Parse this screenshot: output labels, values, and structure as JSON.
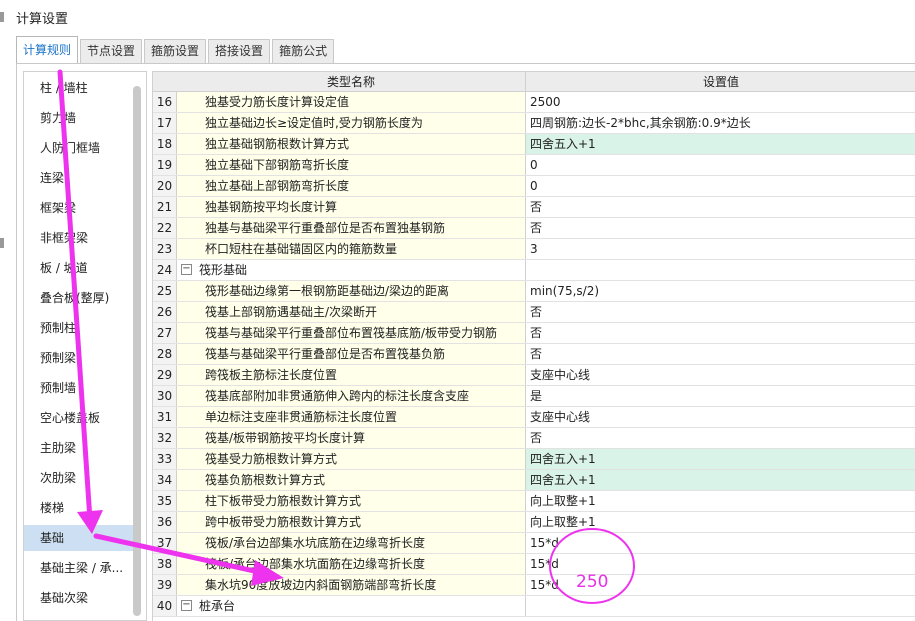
{
  "window": {
    "title": "计算设置"
  },
  "tabs": [
    {
      "label": "计算规则",
      "active": true
    },
    {
      "label": "节点设置",
      "active": false
    },
    {
      "label": "箍筋设置",
      "active": false
    },
    {
      "label": "搭接设置",
      "active": false
    },
    {
      "label": "箍筋公式",
      "active": false
    }
  ],
  "sidebar": {
    "items": [
      {
        "label": "柱 / 墙柱"
      },
      {
        "label": "剪力墙"
      },
      {
        "label": "人防门框墙"
      },
      {
        "label": "连梁"
      },
      {
        "label": "框架梁"
      },
      {
        "label": "非框架梁"
      },
      {
        "label": "板 / 坡道"
      },
      {
        "label": "叠合板(整厚)"
      },
      {
        "label": "预制柱"
      },
      {
        "label": "预制梁"
      },
      {
        "label": "预制墙"
      },
      {
        "label": "空心楼盖板"
      },
      {
        "label": "主肋梁"
      },
      {
        "label": "次肋梁"
      },
      {
        "label": "楼梯"
      },
      {
        "label": "基础",
        "selected": true
      },
      {
        "label": "基础主梁 / 承..."
      },
      {
        "label": "基础次梁"
      }
    ]
  },
  "grid": {
    "header": {
      "name": "类型名称",
      "value": "设置值"
    },
    "rows": [
      {
        "num": "16",
        "name": "独基受力筋长度计算设定值",
        "value": "2500"
      },
      {
        "num": "17",
        "name": "独立基础边长≥设定值时,受力钢筋长度为",
        "value": "四周钢筋:边长-2*bhc,其余钢筋:0.9*边长"
      },
      {
        "num": "18",
        "name": "独立基础钢筋根数计算方式",
        "value": "四舍五入+1",
        "highlight": true
      },
      {
        "num": "19",
        "name": "独立基础下部钢筋弯折长度",
        "value": "0"
      },
      {
        "num": "20",
        "name": "独立基础上部钢筋弯折长度",
        "value": "0"
      },
      {
        "num": "21",
        "name": "独基钢筋按平均长度计算",
        "value": "否"
      },
      {
        "num": "22",
        "name": "独基与基础梁平行重叠部位是否布置独基钢筋",
        "value": "否"
      },
      {
        "num": "23",
        "name": "杯口短柱在基础锚固区内的箍筋数量",
        "value": "3"
      },
      {
        "num": "24",
        "name": "筏形基础",
        "value": "",
        "group": true,
        "toggle": "−"
      },
      {
        "num": "25",
        "name": "筏形基础边缘第一根钢筋距基础边/梁边的距离",
        "value": "min(75,s/2)"
      },
      {
        "num": "26",
        "name": "筏基上部钢筋遇基础主/次梁断开",
        "value": "否"
      },
      {
        "num": "27",
        "name": "筏基与基础梁平行重叠部位布置筏基底筋/板带受力钢筋",
        "value": "否"
      },
      {
        "num": "28",
        "name": "筏基与基础梁平行重叠部位是否布置筏基负筋",
        "value": "否"
      },
      {
        "num": "29",
        "name": "跨筏板主筋标注长度位置",
        "value": "支座中心线"
      },
      {
        "num": "30",
        "name": "筏基底部附加非贯通筋伸入跨内的标注长度含支座",
        "value": "是"
      },
      {
        "num": "31",
        "name": "单边标注支座非贯通筋标注长度位置",
        "value": "支座中心线"
      },
      {
        "num": "32",
        "name": "筏基/板带钢筋按平均长度计算",
        "value": "否"
      },
      {
        "num": "33",
        "name": "筏基受力筋根数计算方式",
        "value": "四舍五入+1",
        "highlight": true
      },
      {
        "num": "34",
        "name": "筏基负筋根数计算方式",
        "value": "四舍五入+1",
        "highlight": true
      },
      {
        "num": "35",
        "name": "柱下板带受力筋根数计算方式",
        "value": "向上取整+1"
      },
      {
        "num": "36",
        "name": "跨中板带受力筋根数计算方式",
        "value": "向上取整+1"
      },
      {
        "num": "37",
        "name": "筏板/承台边部集水坑底筋在边缘弯折长度",
        "value": "15*d"
      },
      {
        "num": "38",
        "name": "筏板/承台边部集水坑面筋在边缘弯折长度",
        "value": "15*d"
      },
      {
        "num": "39",
        "name": "集水坑90度放坡边内斜面钢筋端部弯折长度",
        "value": "15*d"
      },
      {
        "num": "40",
        "name": "桩承台",
        "value": "",
        "group": true,
        "toggle": "−"
      }
    ]
  },
  "annotation": {
    "label": "250",
    "color": "#e631e6"
  }
}
